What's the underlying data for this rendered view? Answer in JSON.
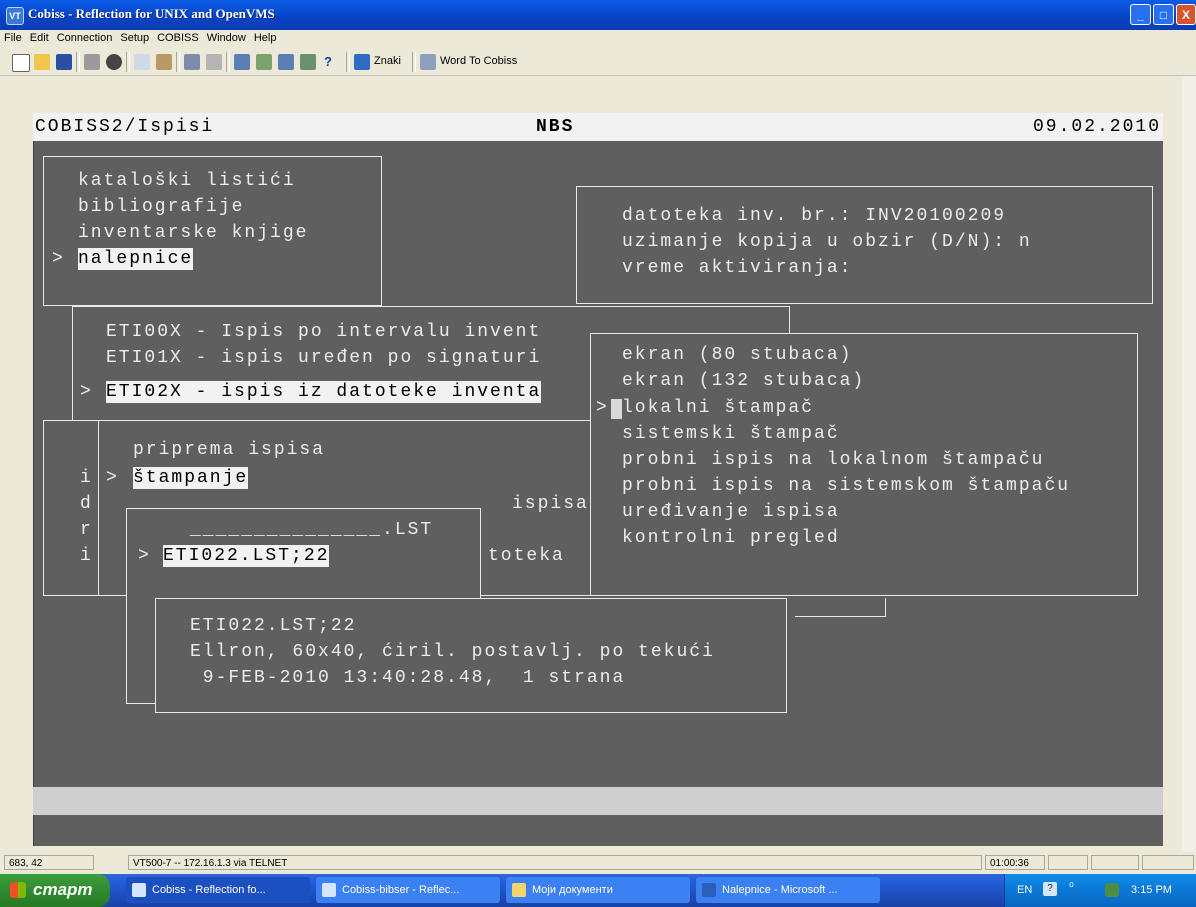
{
  "window": {
    "title": "Cobiss - Reflection for UNIX and OpenVMS",
    "buttons": {
      "minimize": "_",
      "maximize": "□",
      "close": "X"
    }
  },
  "menu": [
    "File",
    "Edit",
    "Connection",
    "Setup",
    "COBISS",
    "Window",
    "Help"
  ],
  "toolbar": {
    "icons": [
      "new-icon",
      "open-icon",
      "save-icon",
      "print-icon",
      "find-icon",
      "copy-icon",
      "paste-icon",
      "connect-icon",
      "disconnect-icon",
      "settings-icon",
      "keyboard-icon",
      "macro-icon",
      "display-icon",
      "help-icon"
    ],
    "znaki_label": "Znaki",
    "word_label": "Word To Cobiss"
  },
  "terminal": {
    "header": {
      "left": "COBISS2/Ispisi",
      "center": "NBS",
      "right": "09.02.2010"
    },
    "menu1": {
      "items": [
        "kataloški listići",
        "bibliografije",
        "inventarske knjige"
      ],
      "selected": "nalepnice"
    },
    "info": {
      "lines": [
        "datoteka inv. br.: INV20100209",
        "uzimanje kopija u obzir (D/N): n",
        "vreme aktiviranja:"
      ]
    },
    "menu2": {
      "items": [
        "ETI00X - Ispis po intervalu invent",
        "ETI01X - ispis uređen po signaturi"
      ],
      "selected": "ETI02X - ispis iz datoteke inventa"
    },
    "menu3": {
      "items": [
        "priprema ispisa"
      ],
      "selected": "štampanje",
      "side_letters": [
        "i",
        "i",
        "d",
        "r",
        "i"
      ],
      "frag_ispisa": "ispisa",
      "frag_toteka": "toteka"
    },
    "filebox": {
      "pattern": "_______________.LST",
      "selected": "ETI022.LST;22"
    },
    "output_menu": {
      "items": [
        "ekran (80 stubaca)",
        "ekran (132 stubaca)"
      ],
      "selected": "lokalni štampač",
      "items_after": [
        "sistemski štampač",
        "probni ispis na lokalnom štampaču",
        "probni ispis na sistemskom štampaču",
        "uređivanje ispisa",
        "kontrolni pregled"
      ]
    },
    "fileinfo": {
      "lines": [
        "ETI022.LST;22",
        "Ellron, 60x40, ćiril. postavlj. po tekući",
        " 9-FEB-2010 13:40:28.48,  1 strana"
      ]
    },
    "prompt": ">"
  },
  "statusbar": {
    "coords": "683, 42",
    "connection": "VT500-7 -- 172.16.1.3 via TELNET",
    "timer": "01:00:36"
  },
  "taskbar": {
    "start": "старт",
    "tasks": [
      "Cobiss - Reflection fo...",
      "Cobiss-bibser - Reflec...",
      "Моји документи",
      "Nalepnice - Microsoft ..."
    ],
    "lang": "EN",
    "clock": "3:15 PM"
  }
}
